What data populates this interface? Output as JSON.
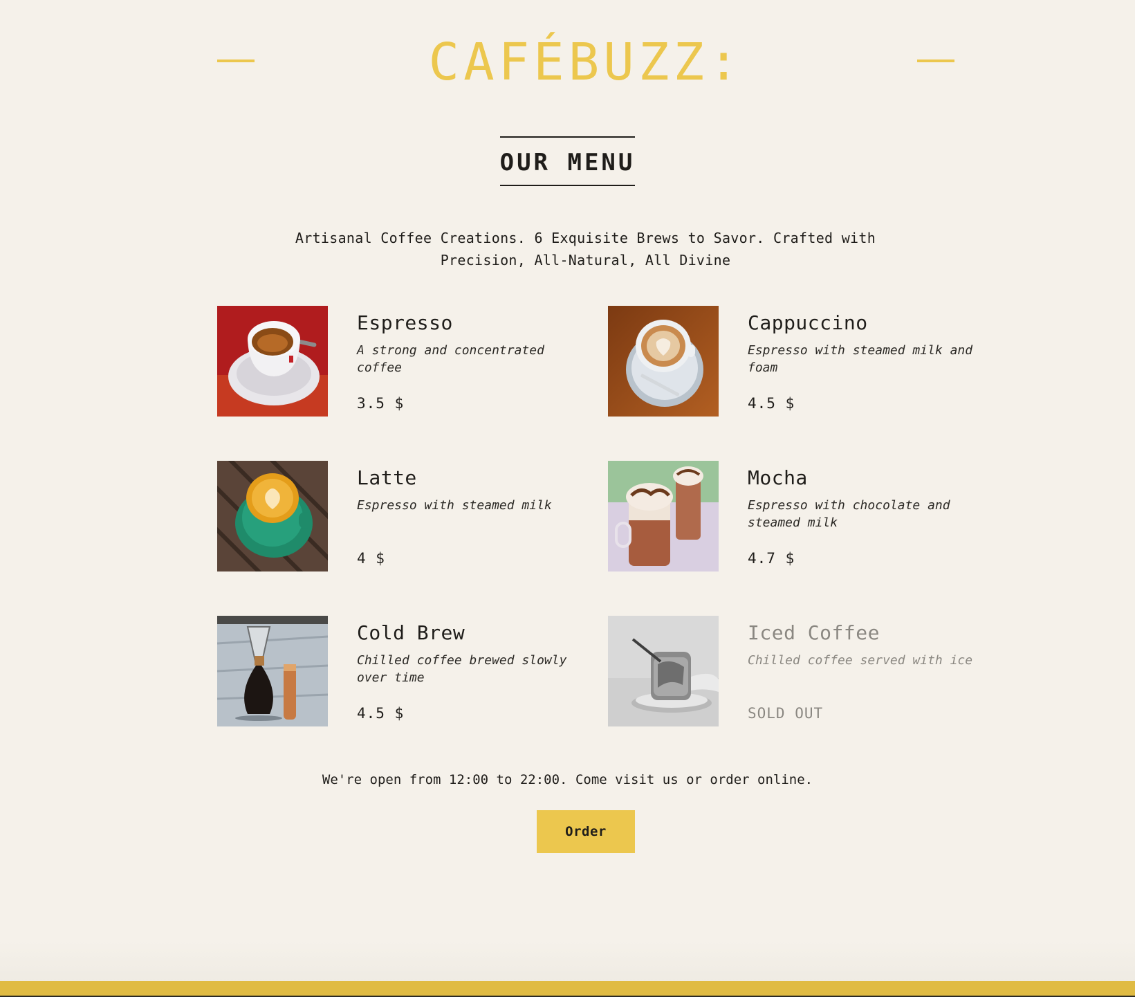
{
  "brand": {
    "name": "CAFÉBUZZ:"
  },
  "menu": {
    "title": "OUR MENU",
    "tagline": "Artisanal Coffee Creations. 6 Exquisite Brews to Savor. Crafted with Precision, All-Natural, All Divine",
    "items": [
      {
        "name": "Espresso",
        "description": "A strong and concentrated coffee",
        "price": "3.5 $",
        "image": "espresso-cup-photo",
        "sold_out": false
      },
      {
        "name": "Cappuccino",
        "description": "Espresso with steamed milk and foam",
        "price": "4.5 $",
        "image": "cappuccino-latte-art-photo",
        "sold_out": false
      },
      {
        "name": "Latte",
        "description": "Espresso with steamed milk",
        "price": "4 $",
        "image": "latte-green-cup-photo",
        "sold_out": false
      },
      {
        "name": "Mocha",
        "description": "Espresso with chocolate and steamed milk",
        "price": "4.7 $",
        "image": "mocha-glasses-photo",
        "sold_out": false
      },
      {
        "name": "Cold Brew",
        "description": "Chilled coffee brewed slowly over time",
        "price": "4.5 $",
        "image": "cold-brew-chemex-photo",
        "sold_out": false
      },
      {
        "name": "Iced Coffee",
        "description": "Chilled coffee served with ice",
        "price": "SOLD OUT",
        "image": "iced-coffee-glass-photo",
        "sold_out": true
      }
    ]
  },
  "footer": {
    "hours_text": "We're open from 12:00 to 22:00. Come visit us or order online.",
    "order_label": "Order"
  },
  "colors": {
    "background": "#f5f1ea",
    "accent": "#ecc74e",
    "text": "#1f1d1a",
    "muted": "#8a8781",
    "bottom_bar": "#e0bb43"
  }
}
